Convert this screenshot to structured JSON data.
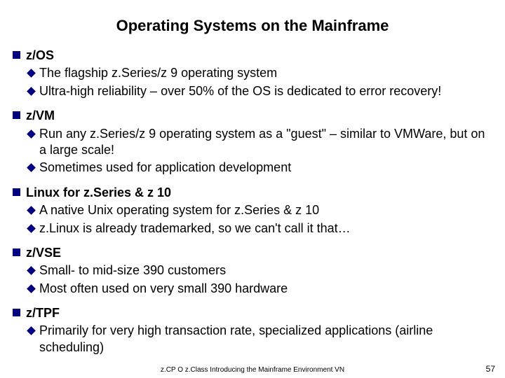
{
  "title": "Operating Systems on the Mainframe",
  "items": [
    {
      "label": "z/OS",
      "subs": [
        "The flagship z.Series/z 9 operating system",
        "Ultra-high reliability – over 50% of the OS is dedicated to error recovery!"
      ]
    },
    {
      "label": "z/VM",
      "subs": [
        "Run any z.Series/z 9 operating system as a \"guest\" – similar to VMWare, but on a large scale!",
        "Sometimes used for application development"
      ]
    },
    {
      "label": "Linux for z.Series & z 10",
      "subs": [
        "A native Unix operating system for z.Series & z 10",
        "z.Linux is already trademarked, so we can't call it that…"
      ]
    },
    {
      "label": "z/VSE",
      "subs": [
        "Small- to mid-size 390 customers",
        "Most often used on very small 390 hardware"
      ]
    },
    {
      "label": "z/TPF",
      "subs": [
        "Primarily for very high transaction rate, specialized applications (airline scheduling)"
      ]
    }
  ],
  "footer_center": "z.CP O z.Class Introducing the Mainframe Environment VN",
  "footer_right": "57"
}
